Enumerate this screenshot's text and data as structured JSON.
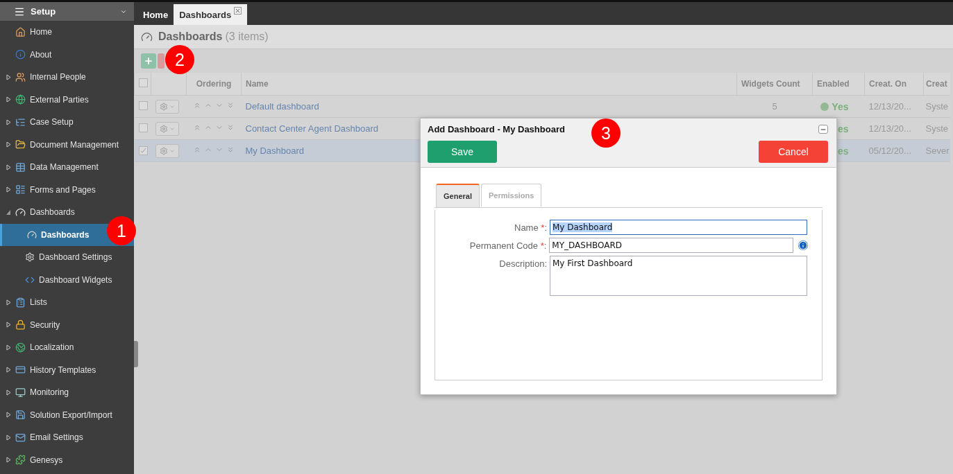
{
  "sidebar": {
    "title": "Setup",
    "items": [
      {
        "label": "Home",
        "expandable": false
      },
      {
        "label": "About",
        "expandable": false
      },
      {
        "label": "Internal People",
        "expandable": true,
        "expanded": false
      },
      {
        "label": "External Parties",
        "expandable": true,
        "expanded": false
      },
      {
        "label": "Case Setup",
        "expandable": true,
        "expanded": false
      },
      {
        "label": "Document Management",
        "expandable": true,
        "expanded": false
      },
      {
        "label": "Data Management",
        "expandable": true,
        "expanded": false
      },
      {
        "label": "Forms and Pages",
        "expandable": true,
        "expanded": false
      },
      {
        "label": "Dashboards",
        "expandable": true,
        "expanded": true,
        "children": [
          {
            "label": "Dashboards",
            "selected": true
          },
          {
            "label": "Dashboard Settings",
            "selected": false
          },
          {
            "label": "Dashboard Widgets",
            "selected": false
          }
        ]
      },
      {
        "label": "Lists",
        "expandable": true,
        "expanded": false
      },
      {
        "label": "Security",
        "expandable": true,
        "expanded": false
      },
      {
        "label": "Localization",
        "expandable": true,
        "expanded": false
      },
      {
        "label": "History Templates",
        "expandable": true,
        "expanded": false
      },
      {
        "label": "Monitoring",
        "expandable": true,
        "expanded": false
      },
      {
        "label": "Solution Export/Import",
        "expandable": true,
        "expanded": false
      },
      {
        "label": "Email Settings",
        "expandable": true,
        "expanded": false
      },
      {
        "label": "Genesys",
        "expandable": true,
        "expanded": false
      }
    ]
  },
  "tabs": [
    {
      "label": "Home",
      "selected": false,
      "closable": false
    },
    {
      "label": "Dashboards",
      "selected": true,
      "closable": true
    }
  ],
  "page": {
    "title": "Dashboards",
    "count": "(3 items)"
  },
  "table": {
    "all_checked": false,
    "columns": [
      "Ordering",
      "Name",
      "Widgets Count",
      "Enabled",
      "Creat. On",
      "Creat"
    ],
    "rows": [
      {
        "checked": false,
        "selected": false,
        "name": "Default dashboard",
        "widgets_count": "5",
        "status_dot": true,
        "enabled": "Yes",
        "created_on": "12/13/20...",
        "column_6": "Syste"
      },
      {
        "checked": false,
        "selected": false,
        "name": "Contact Center Agent Dashboard",
        "status_dot": false,
        "enabled": "es",
        "created_on": "12/13/20...",
        "column_6": "Syste"
      },
      {
        "checked": true,
        "selected": true,
        "name": "My Dashboard",
        "status_dot": false,
        "enabled": "es",
        "created_on": "05/12/20...",
        "column_6": "Sever"
      }
    ]
  },
  "dialog": {
    "title": "Add Dashboard - My Dashboard",
    "save": "Save",
    "cancel": "Cancel",
    "tabs": [
      {
        "label": "General",
        "selected": true
      },
      {
        "label": "Permissions",
        "selected": false
      }
    ],
    "fields": [
      {
        "kind": "input",
        "label": "Name",
        "required_mark": "*",
        "suffix": ":",
        "value": "My Dashboard",
        "focused": true,
        "info": false
      },
      {
        "kind": "input",
        "label": "Permanent Code",
        "required_mark": "*",
        "suffix": ":",
        "value": "MY_DASHBOARD",
        "focused": false,
        "info": true
      },
      {
        "kind": "textarea",
        "label": "Description",
        "suffix": ":",
        "value": "My First Dashboard",
        "focused": false,
        "info": false
      }
    ]
  },
  "callouts": [
    "1",
    "2",
    "3"
  ]
}
